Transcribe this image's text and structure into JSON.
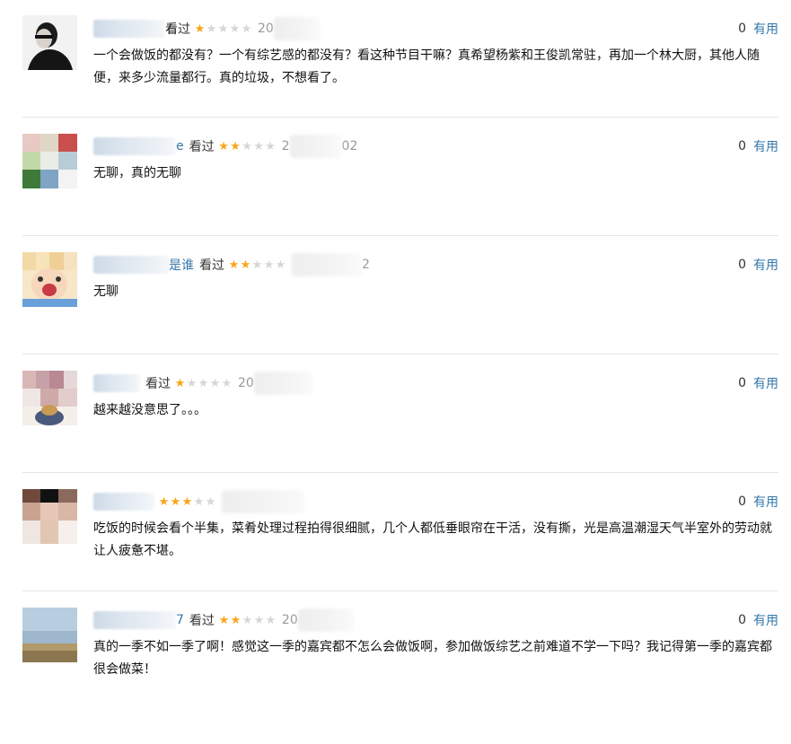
{
  "comments": [
    {
      "name_tail": "看",
      "watched_label": "过",
      "rating": 1,
      "date_visible": "20",
      "date_tail": "",
      "vote_count": "0",
      "vote_label": "有用",
      "text": "一个会做饭的都没有？一个有综艺感的都没有？看这种节目干嘛？真希望杨紫和王俊凯常驻，再加一个林大厨，其他人随便，来多少流量都行。真的垃圾，不想看了。"
    },
    {
      "name_tail": "e",
      "watched_label": "看过",
      "rating": 2,
      "date_visible": "2",
      "date_tail": "02",
      "vote_count": "0",
      "vote_label": "有用",
      "text": "无聊，真的无聊"
    },
    {
      "name_tail": "是谁",
      "watched_label": "看过",
      "rating": 2,
      "date_visible": "",
      "date_tail": "2",
      "vote_count": "0",
      "vote_label": "有用",
      "text": "无聊"
    },
    {
      "name_tail": "",
      "watched_label": "看过",
      "rating": 1,
      "date_visible": "20",
      "date_tail": "",
      "vote_count": "0",
      "vote_label": "有用",
      "text": "越来越没意思了。。。"
    },
    {
      "name_tail": "",
      "watched_label": "",
      "rating": 3,
      "date_visible": "",
      "date_tail": "",
      "vote_count": "0",
      "vote_label": "有用",
      "text": "吃饭的时候会看个半集，菜肴处理过程拍得很细腻，几个人都低垂眼帘在干活，没有撕，光是高温潮湿天气半室外的劳动就让人疲惫不堪。"
    },
    {
      "name_tail": "7",
      "watched_label": "看过",
      "rating": 2,
      "date_visible": "20",
      "date_tail": "",
      "vote_count": "0",
      "vote_label": "有用",
      "text": "真的一季不如一季了啊！感觉这一季的嘉宾都不怎么会做饭啊，参加做饭综艺之前难道不学一下吗？我记得第一季的嘉宾都很会做菜！"
    }
  ],
  "colors": {
    "link": "#3377aa",
    "star_on": "#f9a51b",
    "star_off": "#d6d6d6",
    "meta_gray": "#999999"
  }
}
